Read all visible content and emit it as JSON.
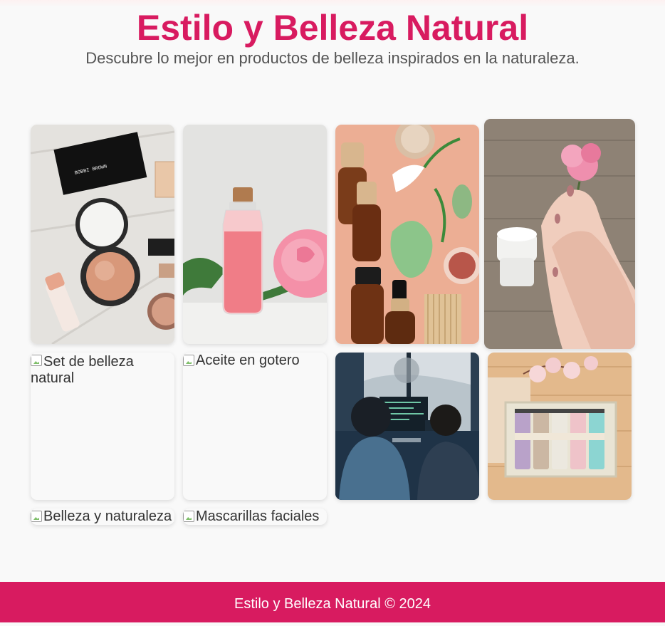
{
  "header": {
    "title": "Estilo y Belleza Natural",
    "subtitle": "Descubre lo mejor en productos de belleza inspirados en la naturaleza."
  },
  "gallery": {
    "images": [
      {
        "alt": "Set de belleza natural",
        "status": "loaded",
        "icon": "makeup-compact-image"
      },
      {
        "alt": "Aceite en gotero",
        "status": "loaded",
        "icon": "pink-oil-bottle-image"
      },
      {
        "alt": "Belleza y naturaleza",
        "status": "loaded",
        "icon": "skincare-flatlay-image"
      },
      {
        "alt": "Mascarillas faciales",
        "status": "loaded",
        "icon": "hands-with-rose-image"
      },
      {
        "alt": "Set de belleza natural",
        "status": "broken"
      },
      {
        "alt": "Aceite en gotero",
        "status": "broken"
      },
      {
        "alt": "",
        "status": "loaded",
        "icon": "people-at-computers-image"
      },
      {
        "alt": "",
        "status": "loaded",
        "icon": "bath-salts-box-image"
      },
      {
        "alt": "Belleza y naturaleza",
        "status": "broken"
      },
      {
        "alt": "Mascarillas faciales",
        "status": "broken"
      }
    ]
  },
  "footer": {
    "text": "Estilo y Belleza Natural © 2024"
  },
  "colors": {
    "accent": "#d81b60",
    "background": "#f9f9f9",
    "subtitle": "#555555"
  }
}
